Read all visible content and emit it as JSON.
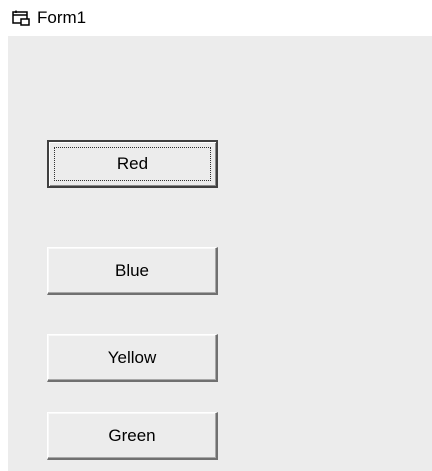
{
  "window": {
    "title": "Form1",
    "icon": "form-window-icon"
  },
  "buttons": [
    {
      "label": "Red",
      "focused": true
    },
    {
      "label": "Blue",
      "focused": false
    },
    {
      "label": "Yellow",
      "focused": false
    },
    {
      "label": "Green",
      "focused": false
    }
  ],
  "colors": {
    "client_background": "#ececec",
    "button_face": "#ececec"
  }
}
